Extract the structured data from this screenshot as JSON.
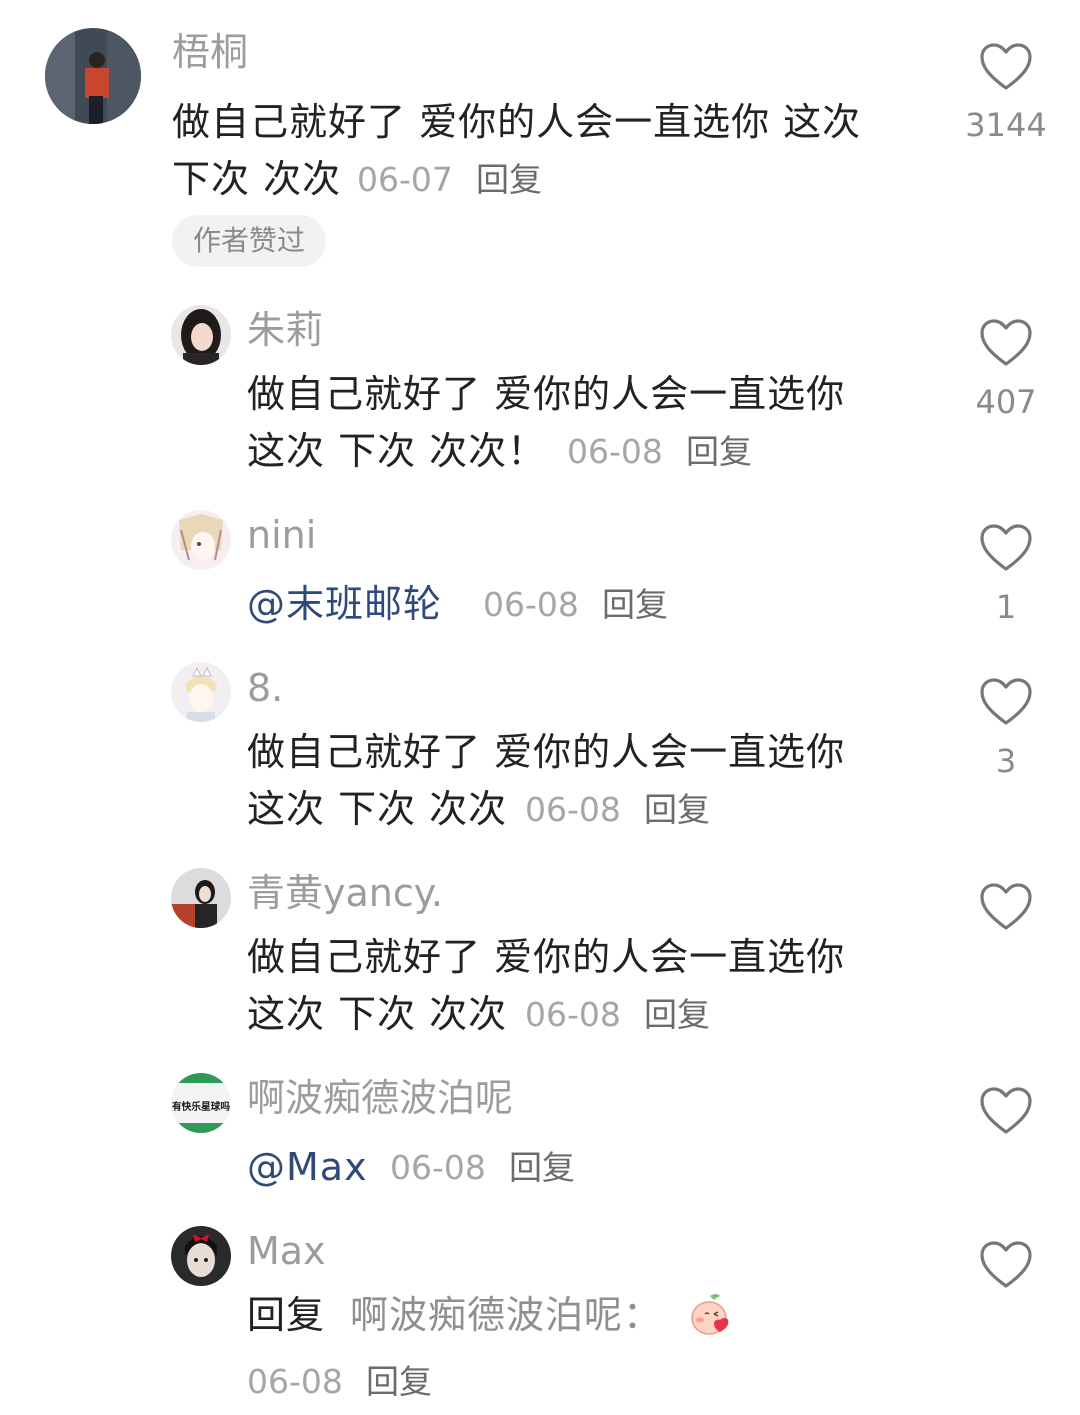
{
  "like_icon": "heart-outline-icon",
  "colors": {
    "username": "#9c9c9c",
    "content": "#222222",
    "mention": "#2f4a7a",
    "meta": "#a6a6a6"
  },
  "comments": [
    {
      "username": "梧桐",
      "lines": [
        "做自己就好了 爱你的人会一直选你 这次",
        "下次 次次"
      ],
      "date": "06-07",
      "reply_label": "回复",
      "badge": "作者赞过",
      "likes": "3144"
    },
    {
      "username": "朱莉",
      "lines": [
        "做自己就好了 爱你的人会一直选你",
        "这次 下次 次次！"
      ],
      "date": "06-08",
      "reply_label": "回复",
      "likes": "407"
    },
    {
      "username": "nini",
      "mention": "@末班邮轮",
      "date": "06-08",
      "reply_label": "回复",
      "likes": "1"
    },
    {
      "username": "8.",
      "lines": [
        "做自己就好了 爱你的人会一直选你",
        "这次 下次 次次"
      ],
      "date": "06-08",
      "reply_label": "回复",
      "likes": "3"
    },
    {
      "username": "青黄yancy.",
      "lines": [
        "做自己就好了 爱你的人会一直选你",
        "这次 下次 次次"
      ],
      "date": "06-08",
      "reply_label": "回复",
      "likes": ""
    },
    {
      "username": "啊波痴德波泊呢",
      "avatar_text": "有快乐星球吗",
      "mention": "@Max",
      "date": "06-08",
      "reply_label": "回复",
      "likes": ""
    },
    {
      "username": "Max",
      "reply_prefix": "回复",
      "reply_to": "啊波痴德波泊呢：",
      "emoji": "blushing-peach-sticker",
      "date": "06-08",
      "reply_label": "回复",
      "likes": ""
    }
  ]
}
